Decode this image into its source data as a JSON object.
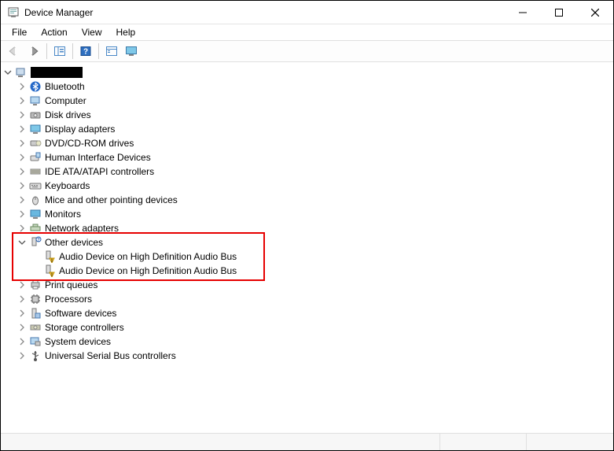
{
  "window": {
    "title": "Device Manager",
    "controls": {
      "min": "—",
      "max": "☐",
      "close": "✕"
    }
  },
  "menu": {
    "file": "File",
    "action": "Action",
    "view": "View",
    "help": "Help"
  },
  "tree": {
    "root": "",
    "bluetooth": "Bluetooth",
    "computer": "Computer",
    "diskdrives": "Disk drives",
    "display": "Display adapters",
    "dvd": "DVD/CD-ROM drives",
    "hid": "Human Interface Devices",
    "ide": "IDE ATA/ATAPI controllers",
    "keyboards": "Keyboards",
    "mice": "Mice and other pointing devices",
    "monitors": "Monitors",
    "network": "Network adapters",
    "other": "Other devices",
    "other_child1": "Audio Device on High Definition Audio Bus",
    "other_child2": "Audio Device on High Definition Audio Bus",
    "printqueues": "Print queues",
    "processors": "Processors",
    "software": "Software devices",
    "storage": "Storage controllers",
    "system": "System devices",
    "usb": "Universal Serial Bus controllers"
  }
}
